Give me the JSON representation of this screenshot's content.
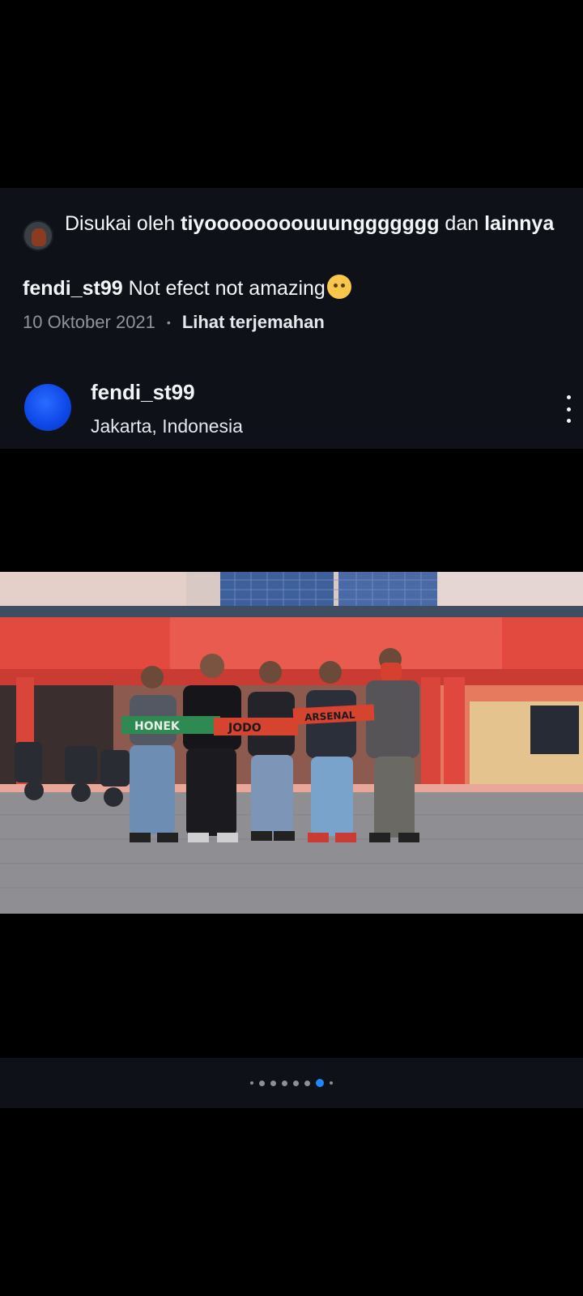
{
  "likes": {
    "prefix": "Disukai oleh ",
    "user": "tiyoooooooouuunggggggg",
    "middle": " dan ",
    "others": "lainnya"
  },
  "caption": {
    "username": "fendi_st99",
    "text": " Not efect not amazing",
    "emoji": "woozy-face-emoji"
  },
  "meta": {
    "date": "10 Oktober 2021",
    "separator": "•",
    "translate_label": "Lihat terjemahan"
  },
  "post": {
    "username": "fendi_st99",
    "location": "Jakarta, Indonesia",
    "more_icon": "more-vertical-icon"
  },
  "photo": {
    "scarf_texts": [
      "HONEK",
      "JODO",
      "ARSENAL"
    ]
  },
  "carousel": {
    "dot_count": 8,
    "active_index": 6
  },
  "colors": {
    "accent": "#1e88ff",
    "panel_bg": "#0e1218",
    "avatar_blue": "#0d47e6"
  }
}
